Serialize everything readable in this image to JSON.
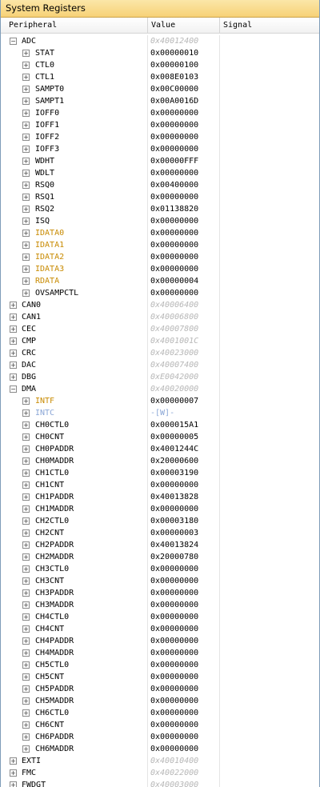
{
  "window": {
    "title": "System Registers"
  },
  "columns": {
    "peripheral": "Peripheral",
    "value": "Value",
    "signal": "Signal"
  },
  "rows": [
    {
      "kind": "top",
      "expanded": true,
      "name": "ADC",
      "value": "0x40012400"
    },
    {
      "kind": "child",
      "name": "STAT",
      "value": "0x00000010"
    },
    {
      "kind": "child",
      "name": "CTL0",
      "value": "0x00000100"
    },
    {
      "kind": "child",
      "name": "CTL1",
      "value": "0x008E0103"
    },
    {
      "kind": "child",
      "name": "SAMPT0",
      "value": "0x00C00000"
    },
    {
      "kind": "child",
      "name": "SAMPT1",
      "value": "0x00A0016D"
    },
    {
      "kind": "child",
      "name": "IOFF0",
      "value": "0x00000000"
    },
    {
      "kind": "child",
      "name": "IOFF1",
      "value": "0x00000000"
    },
    {
      "kind": "child",
      "name": "IOFF2",
      "value": "0x00000000"
    },
    {
      "kind": "child",
      "name": "IOFF3",
      "value": "0x00000000"
    },
    {
      "kind": "child",
      "name": "WDHT",
      "value": "0x00000FFF"
    },
    {
      "kind": "child",
      "name": "WDLT",
      "value": "0x00000000"
    },
    {
      "kind": "child",
      "name": "RSQ0",
      "value": "0x00400000"
    },
    {
      "kind": "child",
      "name": "RSQ1",
      "value": "0x00000000"
    },
    {
      "kind": "child",
      "name": "RSQ2",
      "value": "0x01138820"
    },
    {
      "kind": "child",
      "name": "ISQ",
      "value": "0x00000000"
    },
    {
      "kind": "child",
      "name": "IDATA0",
      "value": "0x00000000",
      "style": "changed"
    },
    {
      "kind": "child",
      "name": "IDATA1",
      "value": "0x00000000",
      "style": "changed"
    },
    {
      "kind": "child",
      "name": "IDATA2",
      "value": "0x00000000",
      "style": "changed"
    },
    {
      "kind": "child",
      "name": "IDATA3",
      "value": "0x00000000",
      "style": "changed"
    },
    {
      "kind": "child",
      "name": "RDATA",
      "value": "0x00000004",
      "style": "changed"
    },
    {
      "kind": "child",
      "name": "OVSAMPCTL",
      "value": "0x00000000"
    },
    {
      "kind": "top",
      "expanded": false,
      "name": "CAN0",
      "value": "0x40006400"
    },
    {
      "kind": "top",
      "expanded": false,
      "name": "CAN1",
      "value": "0x40006800"
    },
    {
      "kind": "top",
      "expanded": false,
      "name": "CEC",
      "value": "0x40007800"
    },
    {
      "kind": "top",
      "expanded": false,
      "name": "CMP",
      "value": "0x4001001C"
    },
    {
      "kind": "top",
      "expanded": false,
      "name": "CRC",
      "value": "0x40023000"
    },
    {
      "kind": "top",
      "expanded": false,
      "name": "DAC",
      "value": "0x40007400"
    },
    {
      "kind": "top",
      "expanded": false,
      "name": "DBG",
      "value": "0xE0042000"
    },
    {
      "kind": "top",
      "expanded": true,
      "name": "DMA",
      "value": "0x40020000"
    },
    {
      "kind": "child",
      "name": "INTF",
      "value": "0x00000007",
      "style": "changed"
    },
    {
      "kind": "child",
      "name": "INTC",
      "value": "-[W]-",
      "style": "wonly"
    },
    {
      "kind": "child",
      "name": "CH0CTL0",
      "value": "0x000015A1"
    },
    {
      "kind": "child",
      "name": "CH0CNT",
      "value": "0x00000005"
    },
    {
      "kind": "child",
      "name": "CH0PADDR",
      "value": "0x4001244C"
    },
    {
      "kind": "child",
      "name": "CH0MADDR",
      "value": "0x20000600"
    },
    {
      "kind": "child",
      "name": "CH1CTL0",
      "value": "0x00003190"
    },
    {
      "kind": "child",
      "name": "CH1CNT",
      "value": "0x00000000"
    },
    {
      "kind": "child",
      "name": "CH1PADDR",
      "value": "0x40013828"
    },
    {
      "kind": "child",
      "name": "CH1MADDR",
      "value": "0x00000000"
    },
    {
      "kind": "child",
      "name": "CH2CTL0",
      "value": "0x00003180"
    },
    {
      "kind": "child",
      "name": "CH2CNT",
      "value": "0x00000003"
    },
    {
      "kind": "child",
      "name": "CH2PADDR",
      "value": "0x40013824"
    },
    {
      "kind": "child",
      "name": "CH2MADDR",
      "value": "0x20000780"
    },
    {
      "kind": "child",
      "name": "CH3CTL0",
      "value": "0x00000000"
    },
    {
      "kind": "child",
      "name": "CH3CNT",
      "value": "0x00000000"
    },
    {
      "kind": "child",
      "name": "CH3PADDR",
      "value": "0x00000000"
    },
    {
      "kind": "child",
      "name": "CH3MADDR",
      "value": "0x00000000"
    },
    {
      "kind": "child",
      "name": "CH4CTL0",
      "value": "0x00000000"
    },
    {
      "kind": "child",
      "name": "CH4CNT",
      "value": "0x00000000"
    },
    {
      "kind": "child",
      "name": "CH4PADDR",
      "value": "0x00000000"
    },
    {
      "kind": "child",
      "name": "CH4MADDR",
      "value": "0x00000000"
    },
    {
      "kind": "child",
      "name": "CH5CTL0",
      "value": "0x00000000"
    },
    {
      "kind": "child",
      "name": "CH5CNT",
      "value": "0x00000000"
    },
    {
      "kind": "child",
      "name": "CH5PADDR",
      "value": "0x00000000"
    },
    {
      "kind": "child",
      "name": "CH5MADDR",
      "value": "0x00000000"
    },
    {
      "kind": "child",
      "name": "CH6CTL0",
      "value": "0x00000000"
    },
    {
      "kind": "child",
      "name": "CH6CNT",
      "value": "0x00000000"
    },
    {
      "kind": "child",
      "name": "CH6PADDR",
      "value": "0x00000000"
    },
    {
      "kind": "child",
      "name": "CH6MADDR",
      "value": "0x00000000"
    },
    {
      "kind": "top",
      "expanded": false,
      "name": "EXTI",
      "value": "0x40010400"
    },
    {
      "kind": "top",
      "expanded": false,
      "name": "FMC",
      "value": "0x40022000"
    },
    {
      "kind": "top",
      "expanded": false,
      "name": "FWDGT",
      "value": "0x40003000"
    }
  ]
}
